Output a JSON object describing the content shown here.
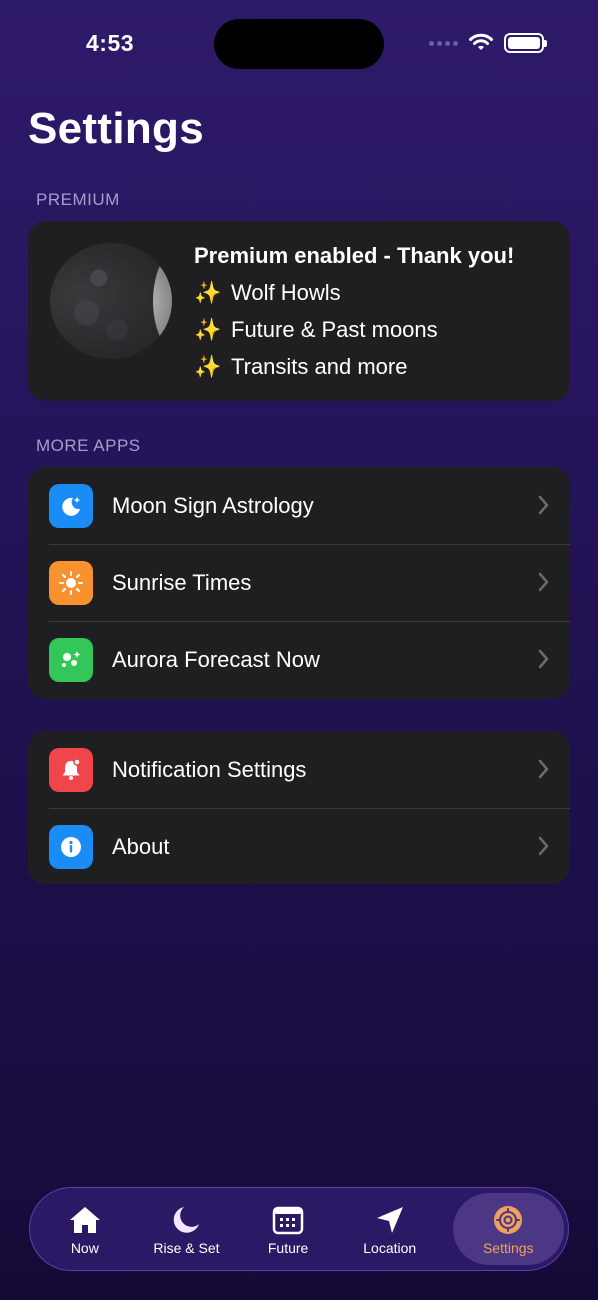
{
  "status_bar": {
    "time": "4:53"
  },
  "page": {
    "title": "Settings"
  },
  "premium": {
    "section_header": "PREMIUM",
    "title": "Premium enabled - Thank you!",
    "features": [
      {
        "icon": "sparkles-icon",
        "glyph": "✨",
        "label": "Wolf Howls"
      },
      {
        "icon": "sparkles-icon",
        "glyph": "✨",
        "label": "Future & Past moons"
      },
      {
        "icon": "sparkles-icon",
        "glyph": "✨",
        "label": "Transits and more"
      }
    ]
  },
  "more_apps": {
    "section_header": "MORE APPS",
    "items": [
      {
        "label": "Moon Sign Astrology",
        "icon": "moon-stars-icon",
        "color": "#1a8cf5"
      },
      {
        "label": "Sunrise Times",
        "icon": "sun-icon",
        "color": "#f7922f"
      },
      {
        "label": "Aurora Forecast Now",
        "icon": "sparkle-circles-icon",
        "color": "#33c759"
      }
    ]
  },
  "other": {
    "items": [
      {
        "label": "Notification Settings",
        "icon": "bell-icon",
        "color": "#f0454a"
      },
      {
        "label": "About",
        "icon": "info-icon",
        "color": "#1a8cf5"
      }
    ]
  },
  "tab_bar": {
    "tabs": [
      {
        "label": "Now",
        "icon": "house-icon",
        "active": false
      },
      {
        "label": "Rise & Set",
        "icon": "moon-icon",
        "active": false
      },
      {
        "label": "Future",
        "icon": "calendar-icon",
        "active": false
      },
      {
        "label": "Location",
        "icon": "location-arrow-icon",
        "active": false
      },
      {
        "label": "Settings",
        "icon": "gear-icon",
        "active": true
      }
    ],
    "active_color": "#f1a15e"
  }
}
